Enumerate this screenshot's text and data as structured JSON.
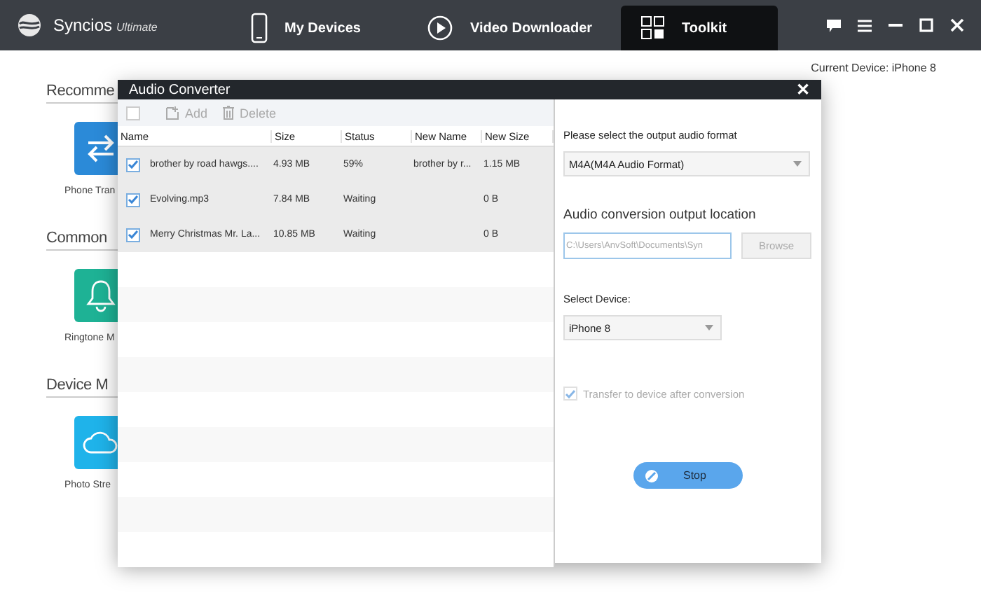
{
  "app": {
    "name": "Syncios",
    "edition": "Ultimate"
  },
  "nav": [
    {
      "label": "My Devices",
      "kind": "phone",
      "selected": false
    },
    {
      "label": "Video Downloader",
      "kind": "play",
      "selected": false
    },
    {
      "label": "Toolkit",
      "kind": "grid",
      "selected": true
    }
  ],
  "current_device": "Current Device: iPhone 8",
  "sections": [
    {
      "title": "Recomme",
      "tile": {
        "label": "Phone Tran",
        "kind": "transfer",
        "color": "#2b8ad8"
      }
    },
    {
      "title": "Common",
      "tile": {
        "label": "Ringtone M",
        "kind": "bell",
        "color": "#1eb295"
      }
    },
    {
      "title": "Device M",
      "tile": {
        "label": "Photo Stre",
        "kind": "cloud",
        "color": "#1fb3ea"
      }
    }
  ],
  "dialog": {
    "title": "Audio Converter",
    "close": "✕",
    "toolbar": {
      "select_all_checked": false,
      "add": "Add",
      "delete": "Delete",
      "disabled": true
    },
    "columns": [
      "Name",
      "Size",
      "Status",
      "New Name",
      "New Size"
    ],
    "rows": [
      {
        "checked": true,
        "name": "brother by road hawgs....",
        "size": "4.93 MB",
        "status": "59%",
        "new_name": "brother by r...",
        "new_size": "1.15 MB"
      },
      {
        "checked": true,
        "name": "Evolving.mp3",
        "size": "7.84 MB",
        "status": "Waiting",
        "new_name": "",
        "new_size": "0 B"
      },
      {
        "checked": true,
        "name": "Merry Christmas Mr. La...",
        "size": "10.85 MB",
        "status": "Waiting",
        "new_name": "",
        "new_size": "0 B"
      }
    ],
    "format_label": "Please select the output audio format",
    "format_value": "M4A(M4A Audio Format)",
    "location_label": "Audio conversion output location",
    "location_value": "C:\\Users\\AnvSoft\\Documents\\Syn",
    "browse": "Browse",
    "device_label": "Select Device:",
    "device_value": "iPhone 8",
    "transfer": {
      "label": "Transfer to device after conversion",
      "checked": true,
      "disabled": true
    },
    "stop": "Stop"
  }
}
